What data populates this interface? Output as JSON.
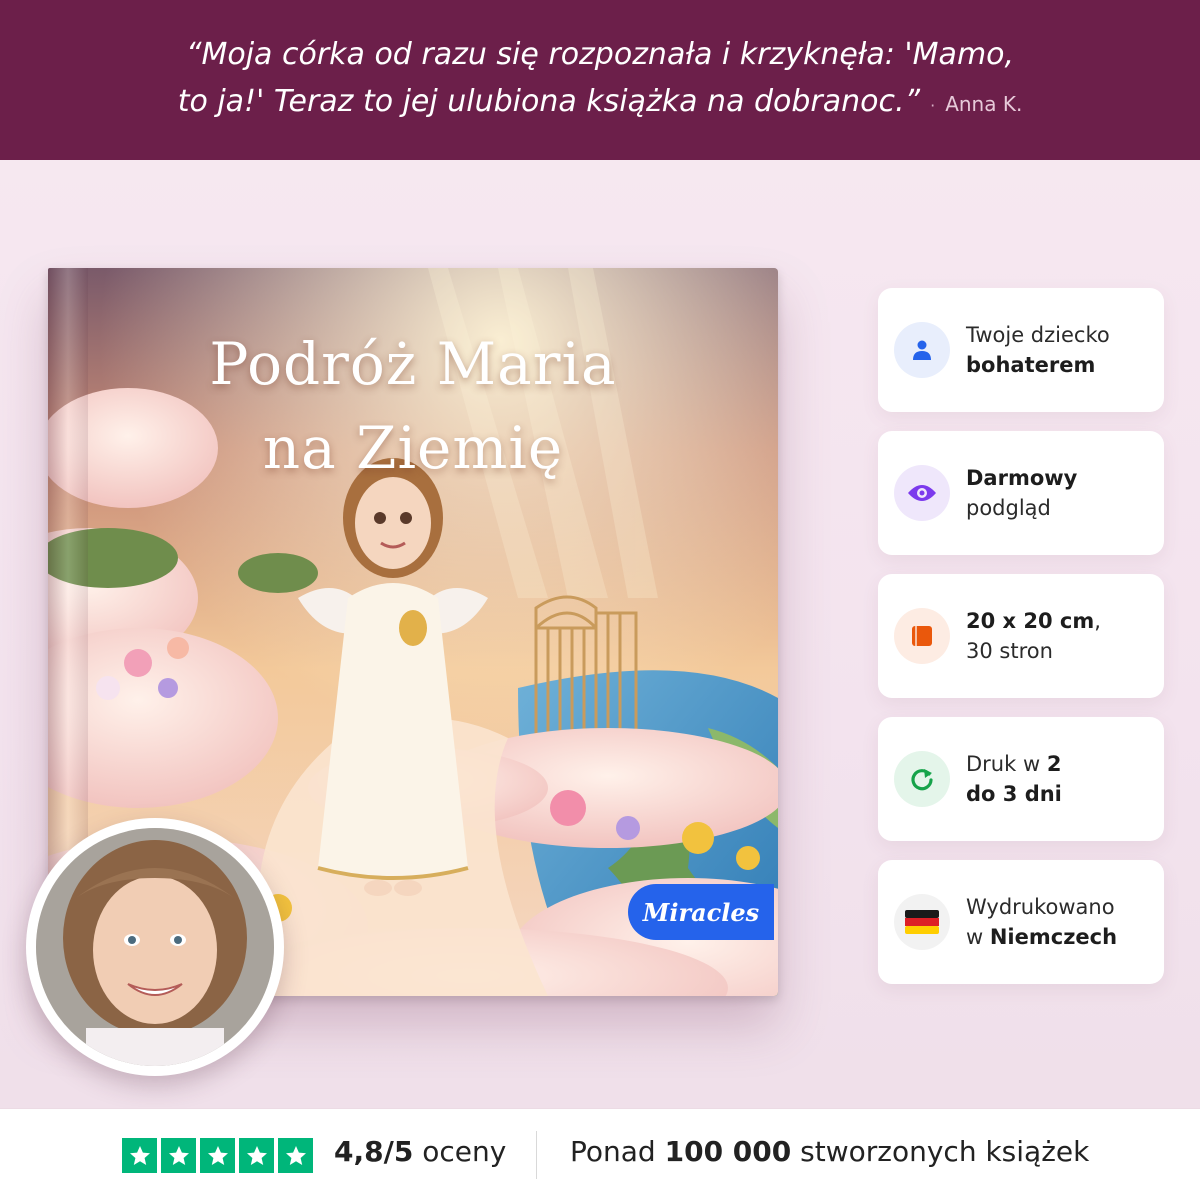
{
  "banner": {
    "quote_line1": "“Moja córka od razu się rozpoznała i krzyknęła: 'Mamo,",
    "quote_line2": "to ja!' Teraz to jej ulubiona książka na dobranoc.”",
    "separator": "·",
    "author": "Anna K."
  },
  "book": {
    "title_line1": "Podróż Maria",
    "title_line2": "na Ziemię",
    "brand": "Miracles"
  },
  "features": [
    {
      "icon": "person-icon",
      "line1_plain": "Twoje dziecko",
      "line2_bold": "bohaterem",
      "color": "#2563eb",
      "bg": "#e8eefc"
    },
    {
      "icon": "eye-icon",
      "line1_bold": "Darmowy",
      "line2_plain": "podgląd",
      "color": "#7c3aed",
      "bg": "#efe7fb"
    },
    {
      "icon": "book-icon",
      "line1_bold": "20 x 20 cm",
      "line1_suffix": ",",
      "line2_plain": "30 stron",
      "color": "#ea580c",
      "bg": "#fdece3"
    },
    {
      "icon": "refresh-icon",
      "line1_plain": "Druk w ",
      "line1_bold": "2",
      "line2_bold": "do 3 dni",
      "color": "#16a34a",
      "bg": "#e4f5ea"
    },
    {
      "icon": "germany-flag-icon",
      "line1_plain": "Wydrukowano",
      "line2_plain": "w ",
      "line2_bold": "Niemczech",
      "bg": "#f2f2f2"
    }
  ],
  "footer": {
    "rating_value": "4,8/5",
    "rating_label": " oceny",
    "count_prefix": "Ponad ",
    "count_value": "100 000",
    "count_suffix": " stworzonych książek",
    "star_count": 5,
    "star_color": "#00b67a"
  }
}
